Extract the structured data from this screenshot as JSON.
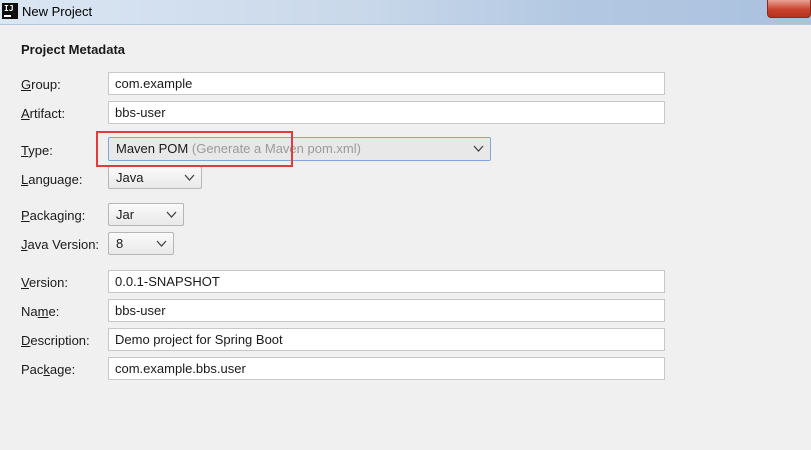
{
  "window": {
    "title": "New Project",
    "app_icon_text": "IJ"
  },
  "section": {
    "title": "Project Metadata"
  },
  "fields": {
    "group": {
      "label_key": "G",
      "label_rest": "roup:",
      "value": "com.example"
    },
    "artifact": {
      "label_key": "A",
      "label_rest": "rtifact:",
      "value": "bbs-user"
    },
    "type": {
      "label_key": "T",
      "label_rest": "ype:",
      "value": "Maven POM",
      "hint": "(Generate a Maven pom.xml)"
    },
    "language": {
      "label_key": "L",
      "label_rest": "anguage:",
      "value": "Java"
    },
    "packaging": {
      "label_key": "P",
      "label_rest": "ackaging:",
      "value": "Jar"
    },
    "java_version": {
      "label_key": "J",
      "label_rest": "ava Version:",
      "value": "8"
    },
    "version": {
      "label_key": "V",
      "label_rest": "ersion:",
      "value": "0.0.1-SNAPSHOT"
    },
    "name": {
      "label_pre": "Na",
      "label_key": "m",
      "label_rest": "e:",
      "value": "bbs-user"
    },
    "description": {
      "label_key": "D",
      "label_rest": "escription:",
      "value": "Demo project for Spring Boot"
    },
    "package": {
      "label_pre": "Pac",
      "label_key": "k",
      "label_rest": "age:",
      "value": "com.example.bbs.user"
    }
  },
  "colors": {
    "highlight": "#e23b3b",
    "focus_border": "#7ea7d8",
    "hint_text": "#9a9a9a"
  }
}
